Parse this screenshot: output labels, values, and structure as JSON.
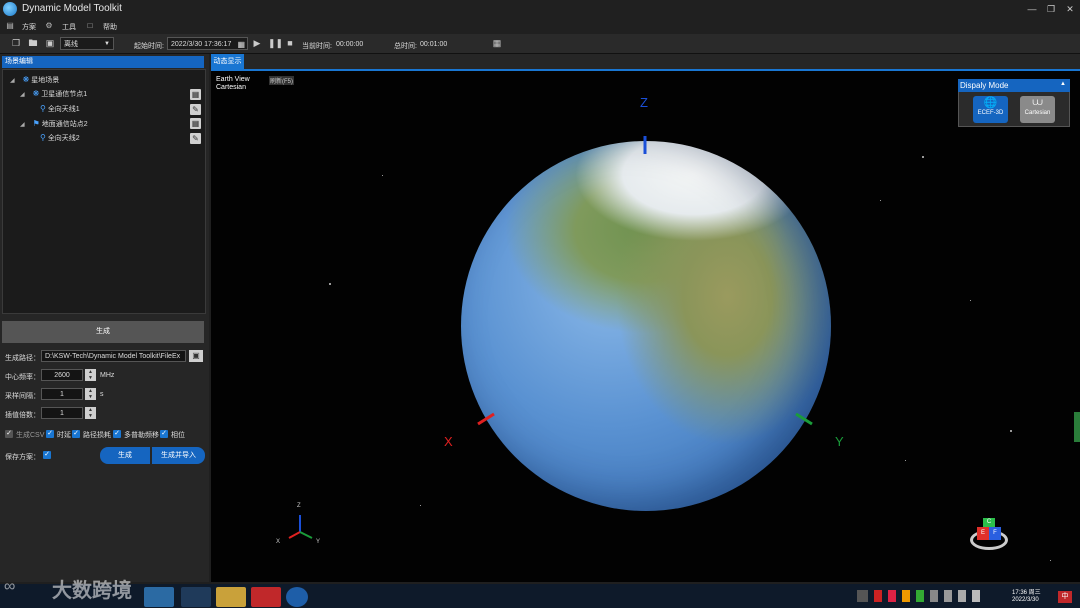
{
  "app": {
    "title": "Dynamic Model Toolkit",
    "window_icons": [
      "minimize-icon",
      "restore-icon",
      "close-icon"
    ]
  },
  "menu": [
    {
      "label": "方案",
      "icon": "document-icon"
    },
    {
      "label": "工具",
      "icon": "gear-icon"
    },
    {
      "label": "帮助",
      "icon": "help-icon"
    }
  ],
  "toolbar": {
    "mode_value": "离线",
    "start_time_label": "起始时间:",
    "start_time_value": "2022/3/30 17:36:17",
    "current_time_label": "当前时间:",
    "current_time_value": "00:00:00",
    "total_time_label": "总时间:",
    "total_time_value": "00:01:00"
  },
  "scene": {
    "panel_title": "场景编辑",
    "tree": [
      {
        "label": "星地场景",
        "level": 0,
        "icon": "scene-icon"
      },
      {
        "label": "卫星通信节点1",
        "level": 1,
        "icon": "satellite-icon",
        "has_action": true
      },
      {
        "label": "全向天线1",
        "level": 2,
        "icon": "antenna-icon",
        "has_action": true
      },
      {
        "label": "地面通信站点2",
        "level": 1,
        "icon": "station-icon",
        "has_action": true
      },
      {
        "label": "全向天线2",
        "level": 2,
        "icon": "antenna-icon",
        "has_action": true
      }
    ]
  },
  "generate": {
    "section_title": "生成",
    "path_label": "生成路径：",
    "path_value": "D:\\KSW-Tech\\Dynamic Model Toolkit\\FileEx",
    "center_freq_label": "中心频率：",
    "center_freq_value": "2600",
    "center_freq_unit": "MHz",
    "sample_interval_label": "采样间隔：",
    "sample_interval_value": "1",
    "sample_interval_unit": "s",
    "interp_label": "插值倍数：",
    "interp_value": "1",
    "checkboxes": [
      {
        "label": "生成CSV",
        "checked": true,
        "disabled": true
      },
      {
        "label": "时延",
        "checked": true
      },
      {
        "label": "路径损耗",
        "checked": true
      },
      {
        "label": "多普勒频移",
        "checked": true
      },
      {
        "label": "相位",
        "checked": true
      }
    ],
    "save_plan_label": "保存方案：",
    "save_plan_checked": true,
    "btn_generate": "生成",
    "btn_generate_import": "生成并导入"
  },
  "view": {
    "tab_label": "动态显示",
    "overlay_line1": "Earth View",
    "overlay_line2": "Cartesian",
    "overlay_badge": "刷新(F5)",
    "axis_z": "Z",
    "axis_x": "X",
    "axis_y": "Y",
    "mini_z": "Z",
    "mini_x": "X",
    "mini_y": "Y",
    "cube_face_labels": [
      "C",
      "E",
      "F"
    ]
  },
  "display_mode": {
    "title": "Dispaly Mode",
    "options": [
      {
        "label": "ECEF-3D",
        "icon": "globe-icon",
        "active": true
      },
      {
        "label": "Cartesian",
        "icon": "axes-icon",
        "active": false
      }
    ]
  },
  "watermark": "大数跨境",
  "taskbar": {
    "time": "17:36 周三",
    "date": "2022/3/30",
    "ime": "中"
  },
  "colors": {
    "accent": "#1976d2",
    "axis_x": "#e02020",
    "axis_y": "#1a9c3a",
    "axis_z": "#1a4fd8"
  }
}
